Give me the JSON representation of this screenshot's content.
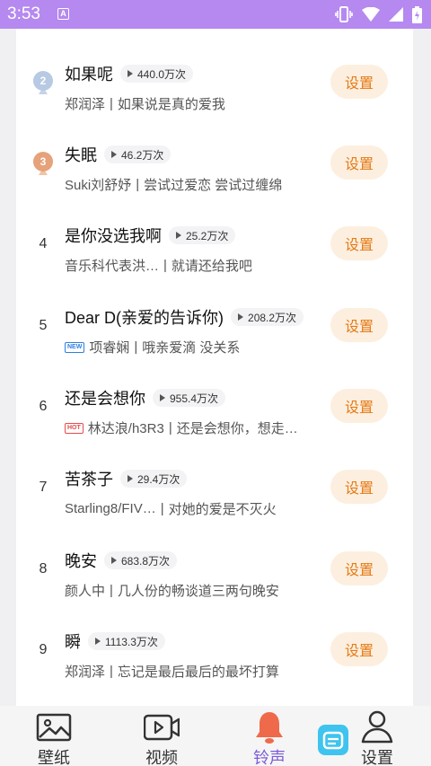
{
  "status_bar": {
    "time": "3:53",
    "notification_letter": "A"
  },
  "colors": {
    "accent": "#7c5bd9",
    "button_bg": "#fdefdf",
    "button_text": "#e47a16",
    "status_bar": "#b589f0"
  },
  "songs": [
    {
      "rank": "2",
      "rank_icon": "silver-medal-icon",
      "title": "如果呢",
      "plays": "440.0万次",
      "artist": "郑润泽",
      "desc": "如果说是真的爱我",
      "badge": "",
      "button": "设置"
    },
    {
      "rank": "3",
      "rank_icon": "bronze-medal-icon",
      "title": "失眠",
      "plays": "46.2万次",
      "artist": "Suki刘舒妤",
      "desc": "尝试过爱恋 尝试过缠绵",
      "badge": "",
      "button": "设置"
    },
    {
      "rank": "4",
      "title": "是你没选我啊",
      "plays": "25.2万次",
      "artist": "音乐科代表洪…",
      "desc": "就请还给我吧",
      "badge": "",
      "button": "设置"
    },
    {
      "rank": "5",
      "title": "Dear D(亲爱的告诉你)",
      "plays": "208.2万次",
      "artist": "项睿娴",
      "desc": "哦亲爱滴 没关系",
      "badge": "NEW",
      "button": "设置"
    },
    {
      "rank": "6",
      "title": "还是会想你",
      "plays": "955.4万次",
      "artist": "林达浪/h3R3",
      "desc": "还是会想你，想走…",
      "badge": "HOT",
      "button": "设置"
    },
    {
      "rank": "7",
      "title": "苦茶子",
      "plays": "29.4万次",
      "artist": "Starling8/FIV…",
      "desc": "对她的爱是不灭火",
      "badge": "",
      "button": "设置"
    },
    {
      "rank": "8",
      "title": "晚安",
      "plays": "683.8万次",
      "artist": "颜人中",
      "desc": "几人份的畅谈道三两句晚安",
      "badge": "",
      "button": "设置"
    },
    {
      "rank": "9",
      "title": "瞬",
      "plays": "1113.3万次",
      "artist": "郑润泽",
      "desc": "忘记是最后最后的最坏打算",
      "badge": "",
      "button": "设置"
    }
  ],
  "tabs": [
    {
      "label": "壁纸",
      "icon": "image-icon"
    },
    {
      "label": "视频",
      "icon": "video-icon"
    },
    {
      "label": "铃声",
      "icon": "bell-icon",
      "active": true
    },
    {
      "label": "设置",
      "icon": "user-icon"
    }
  ]
}
